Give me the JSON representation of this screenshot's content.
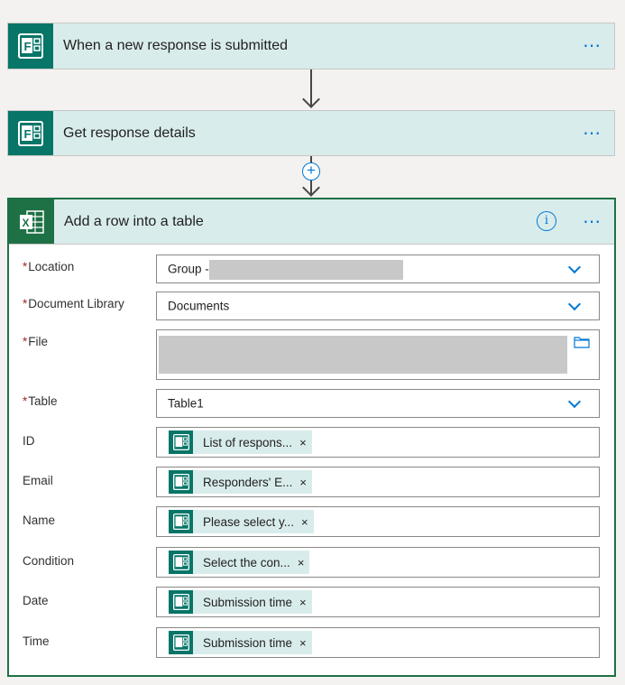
{
  "steps": [
    {
      "title": "When a new response is submitted",
      "icon": "forms-icon",
      "more": "⋯"
    },
    {
      "title": "Get response details",
      "icon": "forms-icon",
      "more": "⋯"
    }
  ],
  "add_step": {
    "icon": "+"
  },
  "action": {
    "title": "Add a row into a table",
    "icon": "excel-icon",
    "info": "i",
    "more": "⋯",
    "required_mark": "*",
    "fields": {
      "location": {
        "label": "Location",
        "value": "Group -"
      },
      "document_library": {
        "label": "Document Library",
        "value": "Documents"
      },
      "file": {
        "label": "File",
        "value": ""
      },
      "table": {
        "label": "Table",
        "value": "Table1"
      },
      "id": {
        "label": "ID",
        "token": "List of respons...",
        "remove": "×"
      },
      "email": {
        "label": "Email",
        "token": "Responders' E...",
        "remove": "×"
      },
      "name": {
        "label": "Name",
        "token": "Please select y...",
        "remove": "×"
      },
      "condition": {
        "label": "Condition",
        "token": "Select the con...",
        "remove": "×"
      },
      "date": {
        "label": "Date",
        "token": "Submission time",
        "remove": "×"
      },
      "time": {
        "label": "Time",
        "token": "Submission time",
        "remove": "×"
      }
    }
  },
  "colors": {
    "forms_green": "#077568",
    "excel_green": "#1e7145",
    "header_bg": "#d9ecec",
    "accent_blue": "#0078d4",
    "required_red": "#a4262c"
  }
}
